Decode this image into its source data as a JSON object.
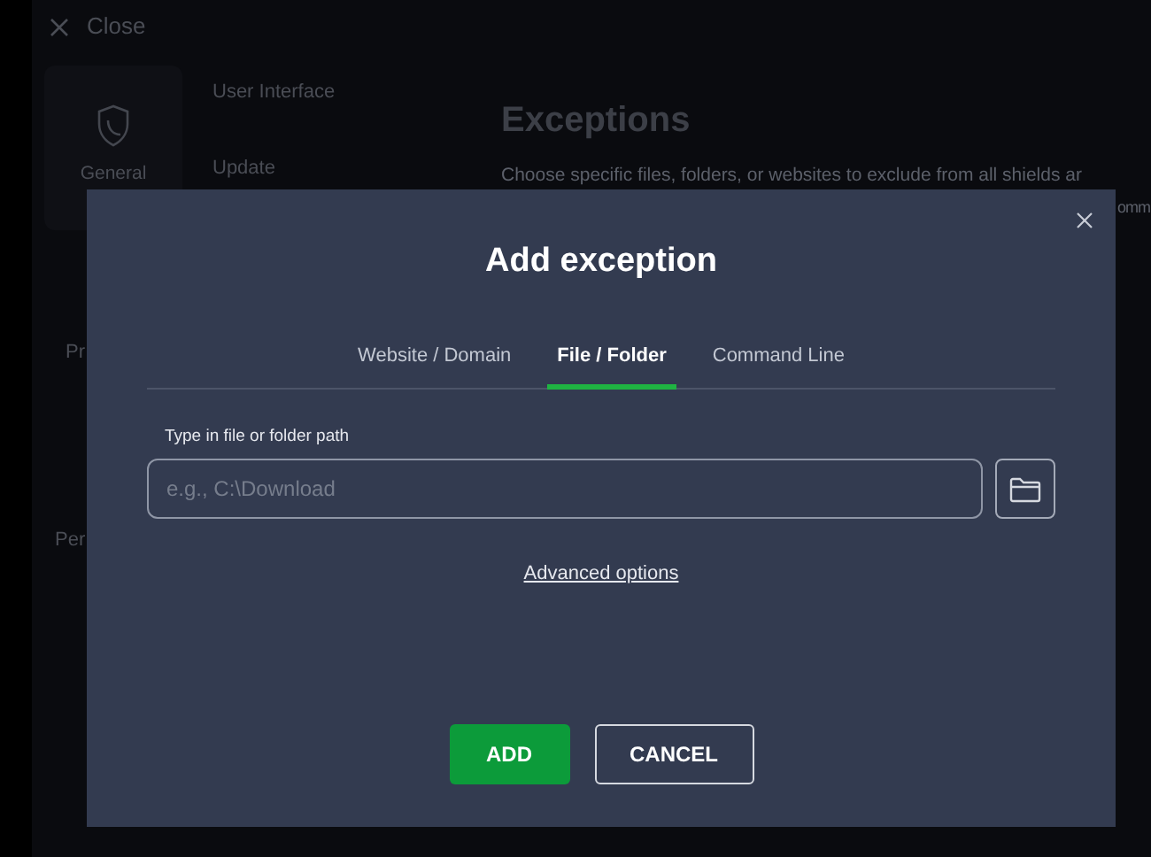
{
  "background": {
    "close_label": "Close",
    "sidebar_card": {
      "label": "General"
    },
    "sidebar_sections": [
      "Pr",
      "Per"
    ],
    "nav_items": [
      "User Interface",
      "Update"
    ],
    "heading": "Exceptions",
    "description": "Choose specific files, folders, or websites to exclude from all shields ar",
    "description_line_2": "omm"
  },
  "dialog": {
    "title": "Add exception",
    "tabs": [
      {
        "label": "Website / Domain",
        "selected": false
      },
      {
        "label": "File / Folder",
        "selected": true
      },
      {
        "label": "Command Line",
        "selected": false
      }
    ],
    "path_field": {
      "label": "Type in file or folder path",
      "placeholder": "e.g., C:\\Download"
    },
    "advanced_link": "Advanced options",
    "buttons": [
      {
        "label": "ADD",
        "kind": "primary"
      },
      {
        "label": "CANCEL",
        "kind": "secondary"
      }
    ]
  }
}
